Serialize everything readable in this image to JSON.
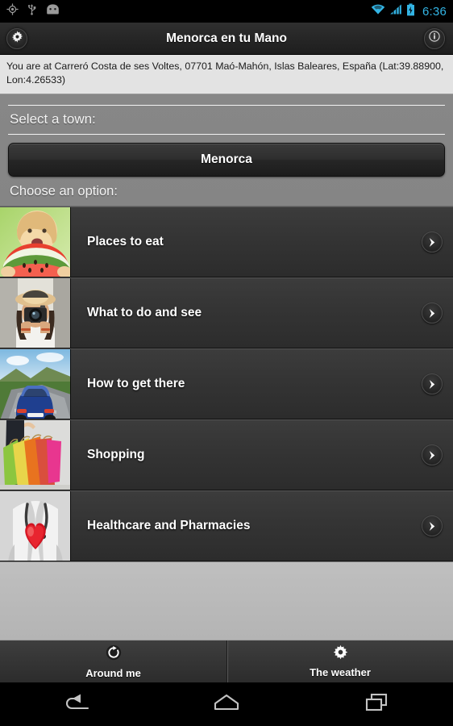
{
  "statusbar": {
    "time": "6:36",
    "left_icons": [
      "gps-location-icon",
      "usb-icon",
      "android-robot-icon"
    ],
    "right_icons": [
      "wifi-icon",
      "cellular-signal-icon",
      "battery-charging-icon"
    ],
    "accent_color": "#33b5e5"
  },
  "actionbar": {
    "title": "Menorca en tu Mano",
    "settings_icon": "gear-icon",
    "info_icon": "info-icon"
  },
  "location": {
    "text": "You are at Carreró Costa de ses Voltes, 07701 Maó-Mahón, Islas Baleares, España (Lat:39.88900, Lon:4.26533)"
  },
  "form": {
    "select_town_label": "Select a town:",
    "town_value": "Menorca",
    "choose_option_label": "Choose an option:"
  },
  "options": [
    {
      "label": "Places to eat",
      "thumb": "child-eating-watermelon-photo",
      "arrow_icon": "chevron-right-icon"
    },
    {
      "label": "What to do and see",
      "thumb": "woman-with-camera-photo",
      "arrow_icon": "chevron-right-icon"
    },
    {
      "label": "How to get there",
      "thumb": "blue-car-on-road-photo",
      "arrow_icon": "chevron-right-icon"
    },
    {
      "label": "Shopping",
      "thumb": "colorful-shopping-bags-photo",
      "arrow_icon": "chevron-right-icon"
    },
    {
      "label": "Healthcare and Pharmacies",
      "thumb": "doctor-holding-red-heart-photo",
      "arrow_icon": "chevron-right-icon"
    }
  ],
  "tabs": [
    {
      "label": "Around me",
      "icon": "refresh-around-me-icon"
    },
    {
      "label": "The weather",
      "icon": "sun-gear-weather-icon"
    }
  ],
  "navbar": {
    "back": "back-icon",
    "home": "home-icon",
    "recents": "recents-icon"
  }
}
